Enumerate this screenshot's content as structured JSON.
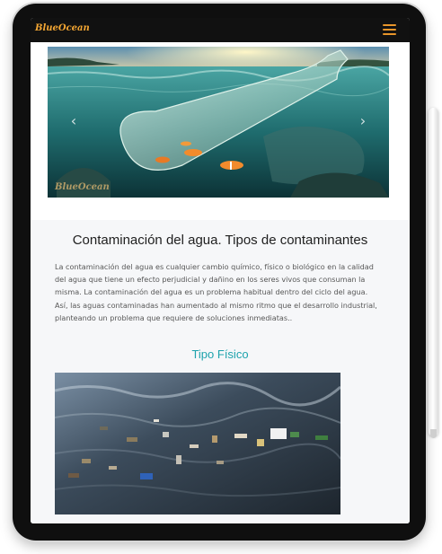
{
  "navbar": {
    "brand": "BlueOcean",
    "menu_icon": "hamburger-menu-icon",
    "brand_color": "#f3a633"
  },
  "hero": {
    "watermark": "BlueOcean",
    "prev_icon": "chevron-left-icon",
    "next_icon": "chevron-right-icon",
    "prev_glyph": "‹",
    "next_glyph": "›"
  },
  "article": {
    "title": "Contaminación del agua. Tipos de contaminantes",
    "paragraph": "La contaminación del agua es cualquier cambio químico, físico o biológico en la calidad del agua que tiene un efecto perjudicial y dañino en los seres vivos que consuman la misma. La contaminación del agua es un problema habitual dentro del ciclo del agua. Así, las aguas contaminadas han aumentado al mismo ritmo que el desarrollo industrial, planteando un problema que requiere de soluciones inmediatas..",
    "subtitle": "Tipo Físico",
    "accent_color": "#1ea3ad"
  }
}
